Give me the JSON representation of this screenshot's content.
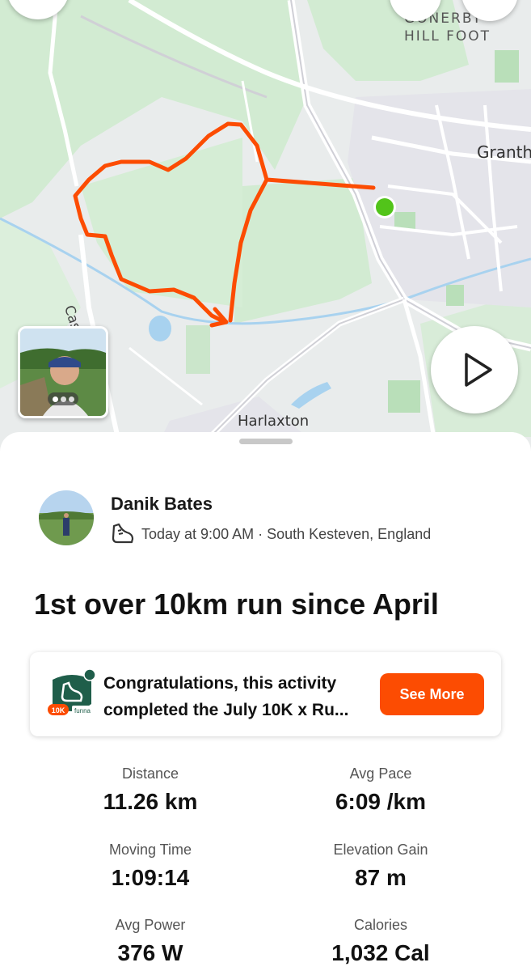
{
  "map": {
    "labels": {
      "village_line1": "GONERBY",
      "village_line2": "HILL FOOT",
      "town": "Granth",
      "road": "Casthorpe Rd",
      "village_south": "Harlaxton"
    },
    "colors": {
      "route": "#fc4c02",
      "start_marker": "#52c41a",
      "park": "#cfe8cf"
    }
  },
  "icons": {
    "back": "back-arrow-icon",
    "bookmark": "bookmark-icon",
    "share": "share-icon",
    "play": "play-icon",
    "shoe": "running-shoe-icon",
    "photo_count": "photo-dots-icon",
    "challenge_badge": "challenge-badge-icon"
  },
  "athlete": {
    "name": "Danik Bates",
    "meta": "Today at 9:00 AM · South Kesteven, England"
  },
  "activity": {
    "title": "1st over 10km run since April"
  },
  "challenge": {
    "line1": "Congratulations, this activity",
    "line2": "completed the July 10K x Ru...",
    "badge_label": "10K",
    "badge_brand": "funna",
    "button_label": "See More"
  },
  "stats": [
    {
      "label": "Distance",
      "value": "11.26 km"
    },
    {
      "label": "Avg Pace",
      "value": "6:09 /km"
    },
    {
      "label": "Moving Time",
      "value": "1:09:14"
    },
    {
      "label": "Elevation Gain",
      "value": "87 m"
    },
    {
      "label": "Avg Power",
      "value": "376 W"
    },
    {
      "label": "Calories",
      "value": "1,032 Cal"
    }
  ],
  "colors": {
    "accent": "#fc4c02"
  }
}
